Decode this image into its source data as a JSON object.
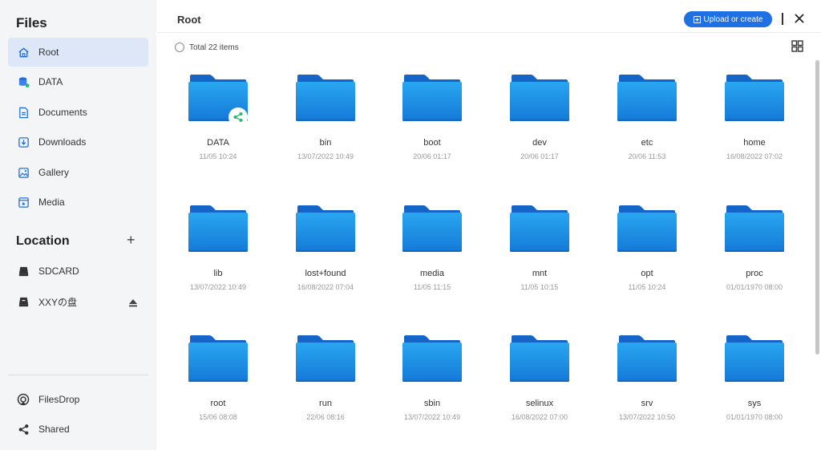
{
  "sidebar": {
    "title": "Files",
    "items": [
      {
        "label": "Root",
        "icon": "home-icon"
      },
      {
        "label": "DATA",
        "icon": "database-shared-icon"
      },
      {
        "label": "Documents",
        "icon": "document-icon"
      },
      {
        "label": "Downloads",
        "icon": "download-icon"
      },
      {
        "label": "Gallery",
        "icon": "image-icon"
      },
      {
        "label": "Media",
        "icon": "media-icon"
      }
    ],
    "location_title": "Location",
    "location_add": "+",
    "locations": [
      {
        "label": "SDCARD",
        "icon": "drive-icon"
      },
      {
        "label": "XXYの盘",
        "icon": "usb-drive-icon"
      }
    ],
    "bottom_items": [
      {
        "label": "FilesDrop",
        "icon": "filesdrop-icon"
      },
      {
        "label": "Shared",
        "icon": "share-icon"
      }
    ]
  },
  "header": {
    "title": "Root",
    "upload_label": "Upload or create"
  },
  "toolbar": {
    "total": "Total 22 items"
  },
  "colors": {
    "accent": "#1f6fe5",
    "folder_front": "#1e8fe6",
    "folder_back": "#1565c8",
    "share_green": "#2fb872"
  },
  "folders": [
    {
      "name": "DATA",
      "date": "11/05 10:24",
      "shared": true
    },
    {
      "name": "bin",
      "date": "13/07/2022 10:49"
    },
    {
      "name": "boot",
      "date": "20/06 01:17"
    },
    {
      "name": "dev",
      "date": "20/06 01:17"
    },
    {
      "name": "etc",
      "date": "20/06 11:53"
    },
    {
      "name": "home",
      "date": "16/08/2022 07:02"
    },
    {
      "name": "lib",
      "date": "13/07/2022 10:49"
    },
    {
      "name": "lost+found",
      "date": "16/08/2022 07:04"
    },
    {
      "name": "media",
      "date": "11/05 11:15"
    },
    {
      "name": "mnt",
      "date": "11/05 10:15"
    },
    {
      "name": "opt",
      "date": "11/05 10:24"
    },
    {
      "name": "proc",
      "date": "01/01/1970 08:00"
    },
    {
      "name": "root",
      "date": "15/06 08:08"
    },
    {
      "name": "run",
      "date": "22/06 08:16"
    },
    {
      "name": "sbin",
      "date": "13/07/2022 10:49"
    },
    {
      "name": "selinux",
      "date": "16/08/2022 07:00"
    },
    {
      "name": "srv",
      "date": "13/07/2022 10:50"
    },
    {
      "name": "sys",
      "date": "01/01/1970 08:00"
    }
  ]
}
